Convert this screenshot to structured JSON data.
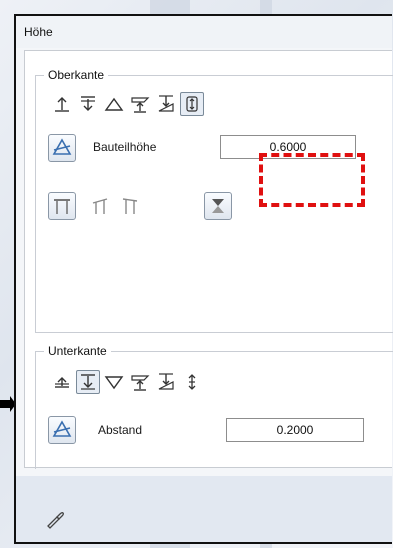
{
  "dialog": {
    "title": "Höhe"
  },
  "oberkante": {
    "label": "Oberkante",
    "icons": [
      "align-top-arrow-icon",
      "align-top-down-icon",
      "triangle-icon",
      "plane-down-icon",
      "slope-down-icon",
      "align-both-icon"
    ],
    "active_icon": "align-both-icon",
    "field_label": "Bauteilhöhe",
    "field_value": "0.6000",
    "extra_icons": [
      "frame-full-icon",
      "frame-left-icon",
      "frame-right-icon",
      "hourglass-icon"
    ]
  },
  "unterkante": {
    "label": "Unterkante",
    "icons": [
      "align-bottom-up-icon",
      "align-bottom-down-icon",
      "triangle-down-icon",
      "plane-down-icon",
      "slope-down-icon",
      "align-both-icon"
    ],
    "active_icon": "align-bottom-down-icon",
    "field_label": "Abstand",
    "field_value": "0.2000"
  },
  "colors": {
    "highlight": "#e01010",
    "accent": "#3a6fb0"
  }
}
